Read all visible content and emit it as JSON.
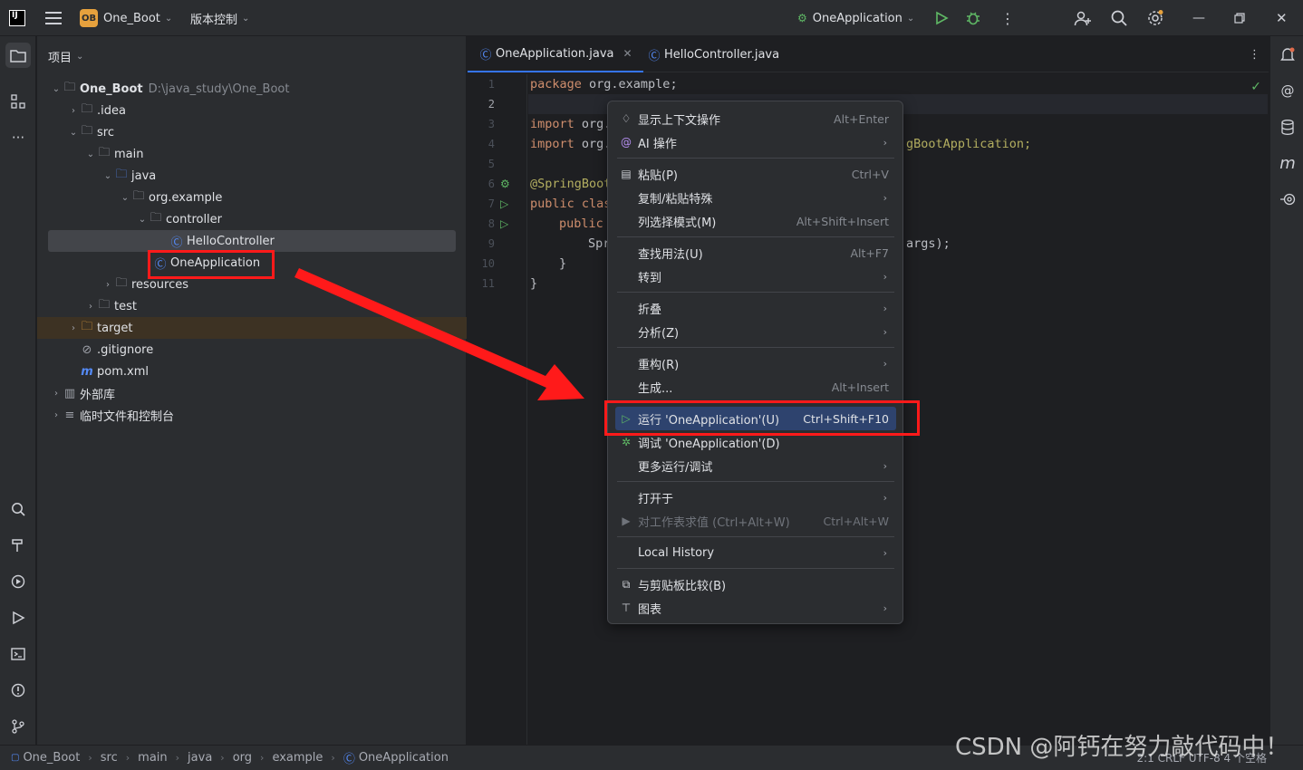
{
  "titlebar": {
    "app_logo": "IJ",
    "project_badge": "OB",
    "project_name": "One_Boot",
    "vcs_label": "版本控制",
    "run_config": "OneApplication"
  },
  "project_panel": {
    "title": "项目",
    "tree": [
      {
        "label": "One_Boot",
        "path": "D:\\java_study\\One_Boot"
      },
      {
        "label": ".idea"
      },
      {
        "label": "src"
      },
      {
        "label": "main"
      },
      {
        "label": "java"
      },
      {
        "label": "org.example"
      },
      {
        "label": "controller"
      },
      {
        "label": "HelloController"
      },
      {
        "label": "OneApplication"
      },
      {
        "label": "resources"
      },
      {
        "label": "test"
      },
      {
        "label": "target"
      },
      {
        "label": ".gitignore"
      },
      {
        "label": "pom.xml"
      },
      {
        "label": "外部库"
      },
      {
        "label": "临时文件和控制台"
      }
    ]
  },
  "editor": {
    "tabs": [
      {
        "label": "OneApplication.java"
      },
      {
        "label": "HelloController.java"
      }
    ],
    "line_numbers": [
      "1",
      "2",
      "3",
      "4",
      "5",
      "6",
      "7",
      "8",
      "9",
      "10",
      "11"
    ],
    "code": {
      "l1_kw": "package",
      "l1_rest": " org.example;",
      "l3_kw": "import",
      "l3_rest": " org.",
      "l4_kw": "import",
      "l4_rest": " org.",
      "l4_tail": "gBootApplication;",
      "l6": "@SpringBoot",
      "l7_kw": "public clas",
      "l8_kw": "public",
      "l9": "Spr",
      "l9_tail": "args);",
      "l10": "}",
      "l11": "}"
    }
  },
  "context_menu": {
    "items": [
      {
        "label": "显示上下文操作",
        "shortcut": "Alt+Enter"
      },
      {
        "label": "AI 操作"
      },
      {
        "label": "粘贴(P)",
        "shortcut": "Ctrl+V"
      },
      {
        "label": "复制/粘贴特殊"
      },
      {
        "label": "列选择模式(M)",
        "shortcut": "Alt+Shift+Insert"
      },
      {
        "label": "查找用法(U)",
        "shortcut": "Alt+F7"
      },
      {
        "label": "转到"
      },
      {
        "label": "折叠"
      },
      {
        "label": "分析(Z)"
      },
      {
        "label": "重构(R)"
      },
      {
        "label": "生成...",
        "shortcut": "Alt+Insert"
      },
      {
        "label": "运行 'OneApplication'(U)",
        "shortcut": "Ctrl+Shift+F10"
      },
      {
        "label": "调试 'OneApplication'(D)"
      },
      {
        "label": "更多运行/调试"
      },
      {
        "label": "打开于"
      },
      {
        "label": "对工作表求值 (Ctrl+Alt+W)",
        "shortcut": "Ctrl+Alt+W"
      },
      {
        "label": "Local History"
      },
      {
        "label": "与剪贴板比较(B)"
      },
      {
        "label": "图表"
      }
    ]
  },
  "statusbar": {
    "breadcrumbs": [
      "One_Boot",
      "src",
      "main",
      "java",
      "org",
      "example",
      "OneApplication"
    ],
    "right": "2:1   CRLF   UTF-8   4 个空格"
  },
  "watermark": "CSDN @阿钙在努力敲代码中！"
}
